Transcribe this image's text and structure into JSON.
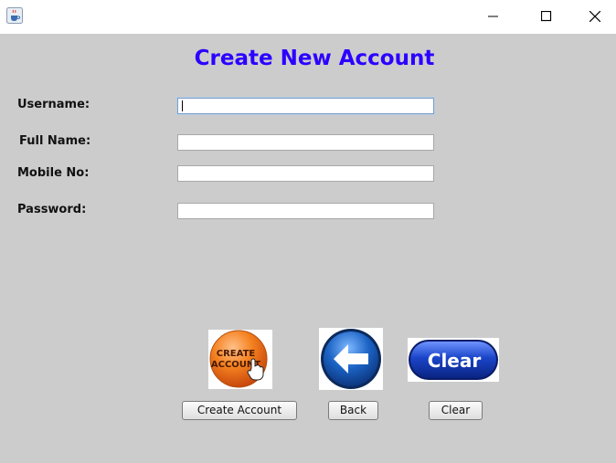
{
  "window": {
    "title": "",
    "icon": "java-cup-icon",
    "controls": [
      "minimize-icon",
      "maximize-icon",
      "close-icon"
    ]
  },
  "form": {
    "heading": "Create New Account",
    "fields": [
      {
        "label": "Username:",
        "value": "",
        "focused": true
      },
      {
        "label": "Full Name:",
        "value": ""
      },
      {
        "label": "Mobile No:",
        "value": ""
      },
      {
        "label": "Password:",
        "value": ""
      }
    ]
  },
  "image_buttons": {
    "create": {
      "text": [
        "CREATE",
        "ACCOUNT"
      ],
      "icon": "hand-pointer-icon",
      "color": "#f26a10"
    },
    "back": {
      "icon": "arrow-left-icon",
      "color": "#1b63c4"
    },
    "clear": {
      "text": "Clear",
      "color": "#1a44c8"
    }
  },
  "buttons": {
    "create_label": "Create Account",
    "back_label": "Back",
    "clear_label": "Clear"
  }
}
